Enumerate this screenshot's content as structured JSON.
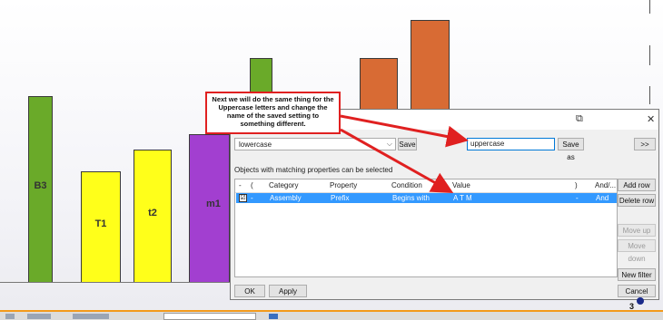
{
  "bars": [
    {
      "label": "B3",
      "color": "#6aaa29"
    },
    {
      "label": "T1",
      "color": "#ffff1a"
    },
    {
      "label": "t2",
      "color": "#ffff1a"
    },
    {
      "label": "m1",
      "color": "#a23fd0"
    },
    {
      "label": "",
      "color": "#6aaa29"
    },
    {
      "label": "",
      "color": "#d86b34"
    },
    {
      "label": "",
      "color": "#d86b34"
    }
  ],
  "callout": {
    "text": "Next we will do the same thing for the Uppercase letters and change the name of the saved setting to something different.",
    "color": "#e02020"
  },
  "dialog": {
    "saved_setting": "lowercase",
    "save_label": "Save",
    "new_name_value": "uppercase",
    "save_as_label": "Save as",
    "expand_label": ">>",
    "info_text": "Objects with matching properties can be selected",
    "columns": [
      "-",
      "(",
      "Category",
      "Property",
      "Condition",
      "Value",
      ")",
      "And/..."
    ],
    "rows": [
      {
        "checked": "☑",
        "dash": "-",
        "open": "",
        "category": "Assembly",
        "property": "Prefix",
        "condition": "Begins with",
        "value": "A T M",
        "close": "-",
        "and_or": "And"
      }
    ],
    "side_buttons": {
      "add_row": "Add row",
      "delete_row": "Delete row",
      "move_up": "Move up",
      "move_down": "Move down",
      "new_filter": "New filter"
    },
    "ok_label": "OK",
    "apply_label": "Apply",
    "cancel_label": "Cancel",
    "help_icon": "help-icon",
    "close_icon": "close-icon",
    "selected_row_color": "#3399ff"
  },
  "page_number": "3"
}
